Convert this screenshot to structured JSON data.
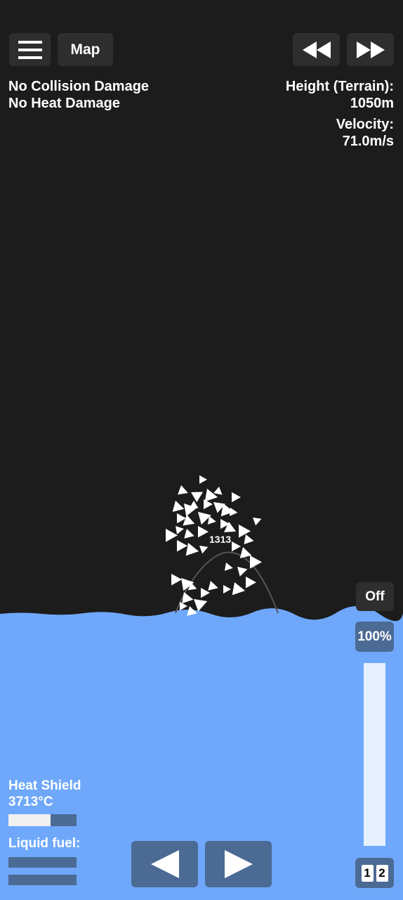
{
  "top_bar": {
    "menu_icon": "hamburger-menu-icon",
    "map_label": "Map",
    "rewind_icon": "rewind-icon",
    "fast_forward_icon": "fast-forward-icon"
  },
  "status": {
    "line1": "No Collision Damage",
    "line2": "No Heat Damage"
  },
  "telemetry": {
    "height_label": "Height (Terrain):",
    "height_value": "1050m",
    "velocity_label": "Velocity:",
    "velocity_value": "71.0m/s"
  },
  "craft": {
    "label": "1313"
  },
  "controls": {
    "toggle_label": "Off",
    "throttle_label": "100%",
    "throttle_level": 1.0,
    "stage_1": "1",
    "stage_2": "2",
    "rotate_left_icon": "triangle-left-icon",
    "rotate_right_icon": "triangle-right-icon"
  },
  "parts": {
    "heat_shield_label": "Heat Shield",
    "heat_shield_temp": "3713°C",
    "heat_shield_level": 0.62,
    "fuel_label": "Liquid fuel:",
    "fuel_level_1": 0.0,
    "fuel_level_2": 0.0
  },
  "colors": {
    "sky": "#1c1c1c",
    "water": "#6fa8fb",
    "button": "#2e2e2e",
    "panel": "#4b6a94"
  }
}
